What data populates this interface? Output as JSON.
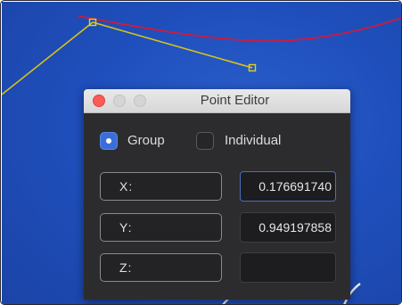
{
  "window": {
    "title": "Point Editor"
  },
  "mode": {
    "options": [
      {
        "label": "Group",
        "selected": true
      },
      {
        "label": "Individual",
        "selected": false
      }
    ]
  },
  "fields": [
    {
      "label": "X:",
      "value": "0.176691740"
    },
    {
      "label": "Y:",
      "value": "0.949197858"
    },
    {
      "label": "Z:",
      "value": ""
    }
  ],
  "colors": {
    "viewport_background": "#1f4fbc",
    "yellow_curve": "#d8c21a",
    "red_curve": "#d11a3a",
    "accent": "#3b6ed8"
  },
  "icons": [
    "close-icon",
    "minimize-icon",
    "zoom-icon"
  ]
}
